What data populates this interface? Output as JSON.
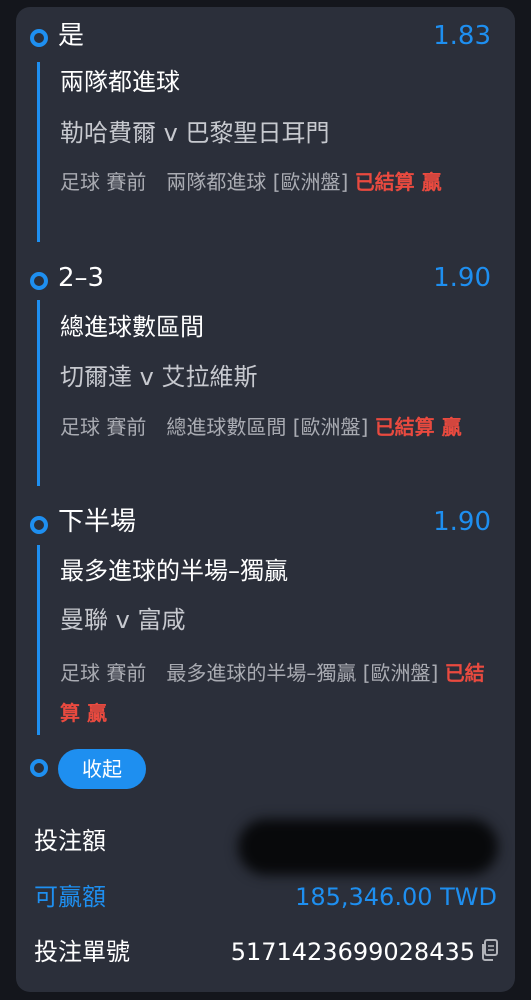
{
  "legs": [
    {
      "selection": "是",
      "odds": "1.83",
      "market": "兩隊都進球",
      "match": "勒哈費爾 v 巴黎聖日耳門",
      "detail_prefix": "足球 賽前　兩隊都進球 [歐洲盤] ",
      "detail_status": "已結算 贏"
    },
    {
      "selection": "2–3",
      "odds": "1.90",
      "market": "總進球數區間",
      "match": "切爾達 v 艾拉維斯",
      "detail_prefix": "足球 賽前　總進球數區間 [歐洲盤] ",
      "detail_status": "已結算 贏"
    },
    {
      "selection": "下半場",
      "odds": "1.90",
      "market": "最多進球的半場–獨贏",
      "match": "曼聯 v 富咸",
      "detail_prefix": "足球 賽前　最多進球的半場–獨贏 [歐洲盤] ",
      "detail_status": "已結算 贏"
    }
  ],
  "collapse_label": "收起",
  "summary": {
    "stake_label": "投注額",
    "potential_win_label": "可贏額",
    "potential_win_value": "185,346.00 TWD",
    "bet_id_label": "投注單號",
    "bet_id_value": "5171423699028435"
  },
  "colors": {
    "accent": "#1e8ff0",
    "win": "#e94a3f",
    "card_bg": "#2b2f3a"
  },
  "icons": {
    "copy": "copy-icon"
  }
}
